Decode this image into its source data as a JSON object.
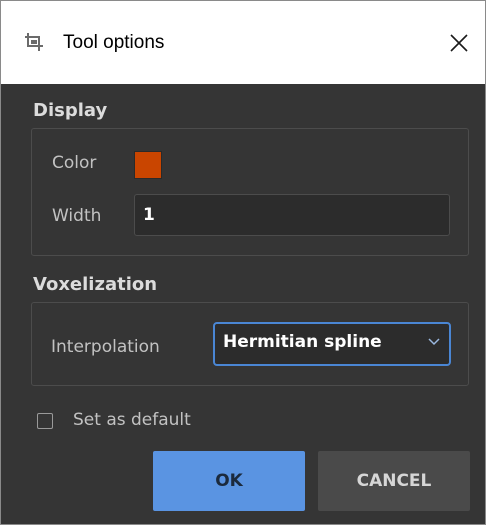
{
  "window": {
    "title": "Tool options",
    "icon": "crop-tool-icon",
    "close_icon": "close-icon"
  },
  "display": {
    "section_title": "Display",
    "color_label": "Color",
    "color_value": "#c94500",
    "width_label": "Width",
    "width_value": "1"
  },
  "voxelization": {
    "section_title": "Voxelization",
    "interpolation_label": "Interpolation",
    "interpolation_value": "Hermitian spline"
  },
  "default_checkbox": {
    "label": "Set as default",
    "checked": false
  },
  "buttons": {
    "ok_label": "OK",
    "cancel_label": "CANCEL"
  },
  "colors": {
    "accent": "#5a94e2",
    "background": "#353535"
  }
}
